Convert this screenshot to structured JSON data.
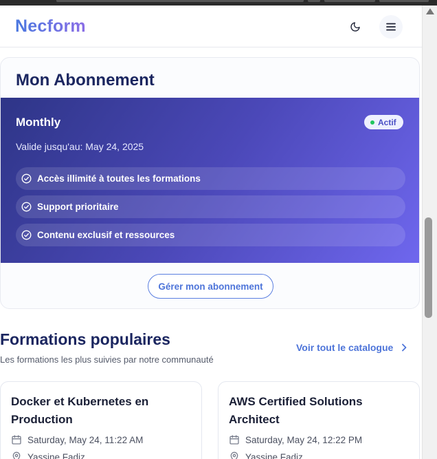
{
  "header": {
    "logo": "Necform",
    "theme_icon": "moon-icon",
    "menu_icon": "hamburger-icon"
  },
  "subscription": {
    "title": "Mon Abonnement",
    "plan": "Monthly",
    "status": "Actif",
    "valid_until": "Valide jusqu'au: May 24, 2025",
    "features": [
      "Accès illimité à toutes les formations",
      "Support prioritaire",
      "Contenu exclusif et ressources"
    ],
    "manage_button": "Gérer mon abonnement"
  },
  "popular": {
    "title": "Formations populaires",
    "subtitle": "Les formations les plus suivies par notre communauté",
    "catalog_link": "Voir tout le catalogue",
    "courses": [
      {
        "title": "Docker et Kubernetes en Production",
        "date": "Saturday, May 24, 11:22 AM",
        "instructor": "Yassine Fadiz"
      },
      {
        "title": "AWS Certified Solutions Architect",
        "date": "Saturday, May 24, 12:22 PM",
        "instructor": "Yassine Fadiz"
      }
    ]
  },
  "colors": {
    "brand_start": "#4a78e0",
    "brand_end": "#8b6ee6",
    "plan_gradient_start": "#2e3587",
    "plan_gradient_end": "#6f67ee",
    "status_dot": "#22c55e",
    "link": "#4d74d9"
  }
}
